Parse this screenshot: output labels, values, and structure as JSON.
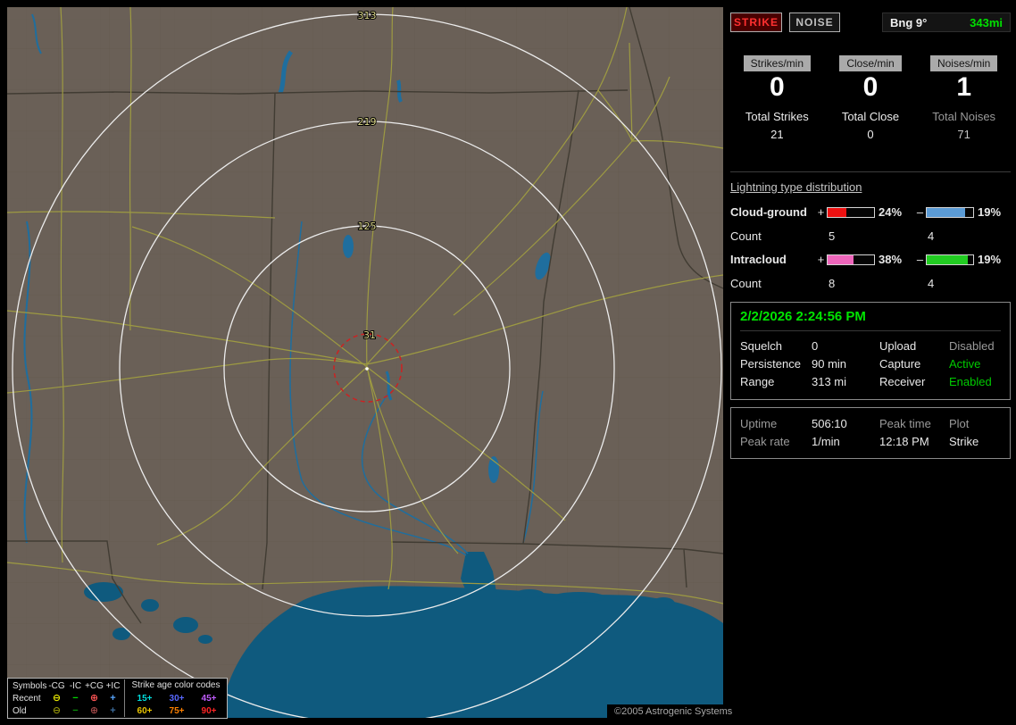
{
  "panel": {
    "strike_button": "STRIKE",
    "noise_button": "NOISE",
    "bearing": {
      "label": "Bng 9°",
      "range": "343mi",
      "range_color": "#00e000"
    },
    "stats": [
      {
        "chip": "Strikes/min",
        "rate": "0",
        "total_label": "Total Strikes",
        "total": "21"
      },
      {
        "chip": "Close/min",
        "rate": "0",
        "total_label": "Total Close",
        "total": "0"
      },
      {
        "chip": "Noises/min",
        "rate": "1",
        "total_label": "Total Noises",
        "total": "71"
      }
    ],
    "distribution": {
      "title": "Lightning type distribution",
      "plus_sign": "+",
      "minus_sign": "–",
      "count_label": "Count",
      "rows": [
        {
          "label": "Cloud-ground",
          "plus_pct": "24%",
          "plus_fill": "40%",
          "plus_color": "#ee1111",
          "plus_count": "5",
          "minus_pct": "19%",
          "minus_fill": "82%",
          "minus_color": "#5b9bd5",
          "minus_count": "4"
        },
        {
          "label": "Intracloud",
          "plus_pct": "38%",
          "plus_fill": "55%",
          "plus_color": "#ee66bb",
          "plus_count": "8",
          "minus_pct": "19%",
          "minus_fill": "88%",
          "minus_color": "#22cc22",
          "minus_count": "4"
        }
      ]
    },
    "status": {
      "datetime": "2/2/2026 2:24:56 PM",
      "rows": [
        {
          "label1": "Squelch",
          "value1": "0",
          "label2": "Upload",
          "value2": "Disabled",
          "value2_color": "#9a9a9a"
        },
        {
          "label1": "Persistence",
          "value1": "90 min",
          "label2": "Capture",
          "value2": "Active",
          "value2_color": "#00cc00"
        },
        {
          "label1": "Range",
          "value1": "313 mi",
          "label2": "Receiver",
          "value2": "Enabled",
          "value2_color": "#00cc00"
        }
      ]
    },
    "info": {
      "rows": [
        {
          "c1": "Uptime",
          "c2": "506:10",
          "c3": "Peak time",
          "c4": "Plot"
        },
        {
          "c1": "Peak rate",
          "c2": "1/min",
          "c3": "12:18 PM",
          "c4": "Strike"
        }
      ]
    }
  },
  "map": {
    "ring_labels": [
      "313",
      "219",
      "125",
      "31"
    ],
    "copyright": "©2005 Astrogenic Systems",
    "legend": {
      "symbols_title": "Symbols",
      "columns": [
        "-CG",
        "-IC",
        "+CG",
        "+IC"
      ],
      "age_title": "Strike age color codes",
      "rows": [
        {
          "label": "Recent",
          "symbols": [
            {
              "glyph": "⊖",
              "color": "#e8e800"
            },
            {
              "glyph": "−",
              "color": "#00dd00"
            },
            {
              "glyph": "⊕",
              "color": "#ff5555"
            },
            {
              "glyph": "+",
              "color": "#58a6ff"
            }
          ],
          "ages": [
            {
              "text": "15+",
              "color": "#00dede"
            },
            {
              "text": "30+",
              "color": "#5868ff"
            },
            {
              "text": "45+",
              "color": "#c05cff"
            }
          ]
        },
        {
          "label": "Old",
          "symbols": [
            {
              "glyph": "⊖",
              "color": "#90900a"
            },
            {
              "glyph": "−",
              "color": "#0a900a"
            },
            {
              "glyph": "⊕",
              "color": "#a04848"
            },
            {
              "glyph": "+",
              "color": "#3c6c9c"
            }
          ],
          "ages": [
            {
              "text": "60+",
              "color": "#e8c400"
            },
            {
              "text": "75+",
              "color": "#ff8000"
            },
            {
              "text": "90+",
              "color": "#ff2424"
            }
          ]
        }
      ]
    }
  }
}
